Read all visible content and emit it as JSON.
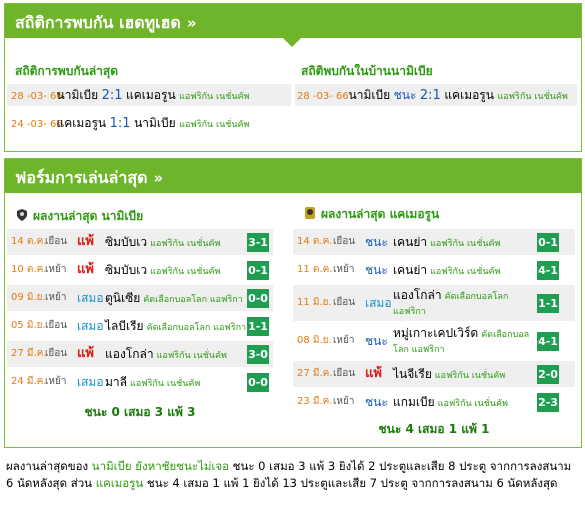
{
  "h2h": {
    "title": "สถิติการพบกัน เฮดทูเฮด",
    "arrow": "»",
    "recent_heading": "สถิติการพบกันล่าสุด",
    "home_heading": "สถิติพบกันในบ้านนามิเบีย",
    "recent": [
      {
        "date": "28 -03- 66",
        "home": "นามิเบีย",
        "score": "2:1",
        "away": "แคเมอรูน",
        "comp": "แอฟริกัน เนชั่นคัพ"
      },
      {
        "date": "24 -03- 66",
        "home": "แคเมอรูน",
        "score": "1:1",
        "away": "นามิเบีย",
        "comp": "แอฟริกัน เนชั่นคัพ"
      }
    ],
    "home": [
      {
        "date": "28 -03- 66",
        "home": "นามิเบีย",
        "result": "ชนะ",
        "score": "2:1",
        "away": "แคเมอรูน",
        "comp": "แอฟริกัน เนชั่นคัพ"
      }
    ]
  },
  "form": {
    "title": "ฟอร์มการเล่นล่าสุด",
    "arrow": "»",
    "left": {
      "heading": "ผลงานล่าสุด นามิเบีย",
      "rows": [
        {
          "date": "14 ต.ค.",
          "venue": "เยือน",
          "result": "แพ้",
          "type": "l",
          "opp": "ซิมบับเว",
          "comp": "แอฟริกัน เนชั่นคัพ",
          "score": "3-1"
        },
        {
          "date": "10 ต.ค.",
          "venue": "เหย้า",
          "result": "แพ้",
          "type": "l",
          "opp": "ซิมบับเว",
          "comp": "แอฟริกัน เนชั่นคัพ",
          "score": "0-1"
        },
        {
          "date": "09 มิ.ย.",
          "venue": "เหย้า",
          "result": "เสมอ",
          "type": "d",
          "opp": "ตูนิเซีย",
          "comp": "คัดเลือกบอลโลก แอฟริกา",
          "score": "0-0"
        },
        {
          "date": "05 มิ.ย.",
          "venue": "เยือน",
          "result": "เสมอ",
          "type": "d",
          "opp": "ไลบีเรีย",
          "comp": "คัดเลือกบอลโลก แอฟริกา",
          "score": "1-1"
        },
        {
          "date": "27 มี.ค.",
          "venue": "เยือน",
          "result": "แพ้",
          "type": "l",
          "opp": "แองโกล่า",
          "comp": "แอฟริกัน เนชั่นคัพ",
          "score": "3-0"
        },
        {
          "date": "24 มี.ค.",
          "venue": "เหย้า",
          "result": "เสมอ",
          "type": "d",
          "opp": "มาลี",
          "comp": "แอฟริกัน เนชั่นคัพ",
          "score": "0-0"
        }
      ],
      "summary": "ชนะ 0 เสมอ 3 แพ้ 3"
    },
    "right": {
      "heading": "ผลงานล่าสุด แคเมอรูน",
      "rows": [
        {
          "date": "14 ต.ค.",
          "venue": "เยือน",
          "result": "ชนะ",
          "type": "w",
          "opp": "เคนย่า",
          "comp": "แอฟริกัน เนชั่นคัพ",
          "score": "0-1"
        },
        {
          "date": "11 ต.ค.",
          "venue": "เหย้า",
          "result": "ชนะ",
          "type": "w",
          "opp": "เคนย่า",
          "comp": "แอฟริกัน เนชั่นคัพ",
          "score": "4-1"
        },
        {
          "date": "11 มิ.ย.",
          "venue": "เยือน",
          "result": "เสมอ",
          "type": "d",
          "opp": "แองโกล่า",
          "comp": "คัดเลือกบอลโลก แอฟริกา",
          "score": "1-1"
        },
        {
          "date": "08 มิ.ย.",
          "venue": "เหย้า",
          "result": "ชนะ",
          "type": "w",
          "opp": "หมู่เกาะเคปเวิร์ด",
          "comp": "คัดเลือกบอลโลก แอฟริกา",
          "score": "4-1"
        },
        {
          "date": "27 มี.ค.",
          "venue": "เยือน",
          "result": "แพ้",
          "type": "l",
          "opp": "ไนจีเรีย",
          "comp": "แอฟริกัน เนชั่นคัพ",
          "score": "2-0"
        },
        {
          "date": "23 มี.ค.",
          "venue": "เหย้า",
          "result": "ชนะ",
          "type": "w",
          "opp": "แกมเบีย",
          "comp": "แอฟริกัน เนชั่นคัพ",
          "score": "2-3"
        }
      ],
      "summary": "ชนะ 4 เสมอ 1 แพ้ 1"
    }
  },
  "note": {
    "p1": "ผลงานล่าสุดของ ",
    "team1": "นามิเบีย ยังหาชัยชนะไม่เจอ",
    "p2": " ชนะ 0 เสมอ 3 แพ้ 3 ยิงได้ 2 ประตูและเสีย 8 ประตู จากการลงสนาม 6 นัดหลังสุด ส่วน ",
    "team2": "แคเมอรูน",
    "p3": " ชนะ 4 เสมอ 1 แพ้ 1 ยิงได้ 13 ประตูและเสีย 7 ประตู จากการลงสนาม 6 นัดหลังสุด"
  },
  "colors": {
    "accent": "#6fb52c",
    "badge": "#1f9e52",
    "loss": "#d8201a",
    "draw": "#1a8fc9",
    "win": "#1a56b8"
  }
}
